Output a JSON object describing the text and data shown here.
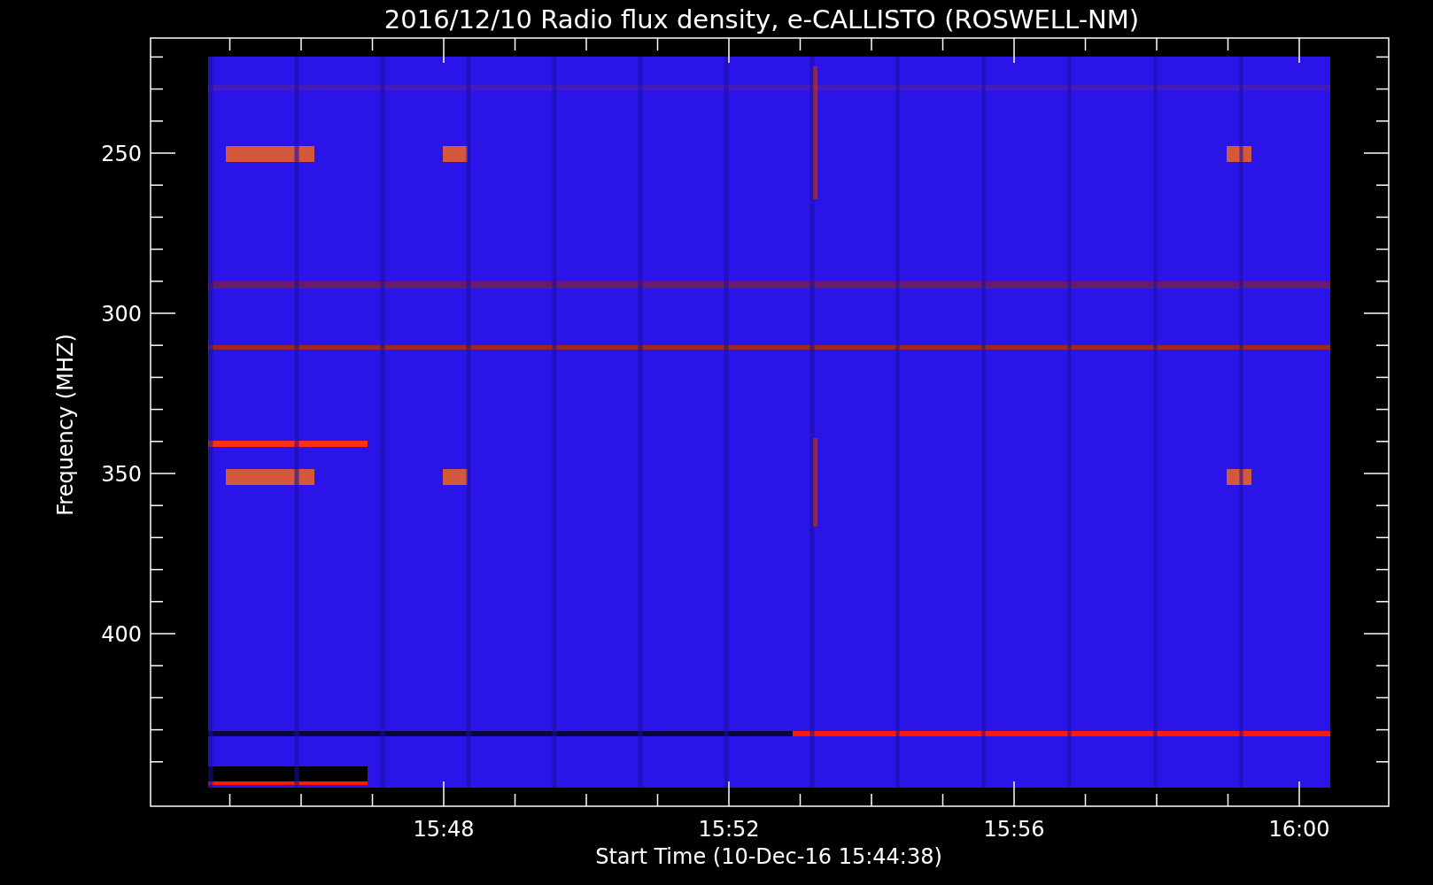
{
  "title": "2016/12/10  Radio flux density, e-CALLISTO (ROSWELL-NM)",
  "y_axis": {
    "label": "Frequency (MHZ)",
    "ticks": [
      "250",
      "300",
      "350",
      "400"
    ]
  },
  "x_axis": {
    "label": "Start Time (10-Dec-16 15:44:38)",
    "ticks": [
      "15:48",
      "15:52",
      "15:56",
      "16:00"
    ]
  }
}
